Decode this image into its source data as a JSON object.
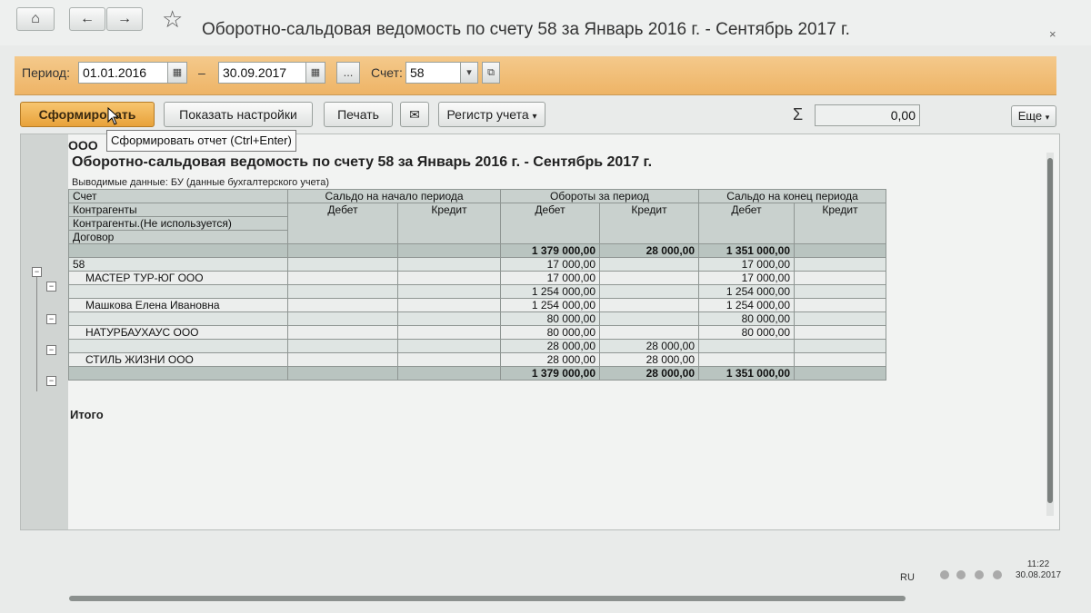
{
  "titlebar": {
    "home_icon": "home-icon",
    "back_icon": "arrow-left-icon",
    "forward_icon": "arrow-right-icon",
    "favorite_icon": "star-icon",
    "title": "Оборотно-сальдовая ведомость по счету 58 за Январь 2016 г. - Сентябрь 2017 г.",
    "close_label": "×"
  },
  "period": {
    "label": "Период:",
    "from": "01.01.2016",
    "dash": "–",
    "to": "30.09.2017",
    "more_label": "...",
    "account_label": "Счет:",
    "account_value": "58"
  },
  "toolbar": {
    "generate_label": "Сформировать",
    "settings_label": "Показать настройки",
    "print_label": "Печать",
    "register_label": "Регистр учета",
    "sum_symbol": "Σ",
    "sum_value": "0,00",
    "more_label": "Еще"
  },
  "tooltip": "Сформировать отчет (Ctrl+Enter)",
  "report": {
    "org": "ООО",
    "title": "Оборотно-сальдовая ведомость по счету 58 за Январь 2016 г. - Сентябрь 2017 г.",
    "output_label": "Выводимые данные:",
    "output_value": "БУ (данные бухгалтерского учета)",
    "headers": {
      "account": "Счет",
      "contractors": "Контрагенты",
      "contractors2": "Контрагенты.(Не используется)",
      "contract": "Договор",
      "opening": "Сальдо на начало периода",
      "turnover": "Обороты за период",
      "closing": "Сальдо на конец периода",
      "debit": "Дебет",
      "credit": "Кредит"
    },
    "rows": [
      {
        "name": "",
        "t_dt": "1 379 000,00",
        "t_ct": "28 000,00",
        "c_dt": "1 351 000,00"
      },
      {
        "name": "58",
        "t_dt": "17 000,00",
        "t_ct": "",
        "c_dt": "17 000,00"
      },
      {
        "name": "МАСТЕР ТУР-ЮГ ООО",
        "t_dt": "17 000,00",
        "t_ct": "",
        "c_dt": "17 000,00"
      },
      {
        "name": "",
        "t_dt": "1 254 000,00",
        "t_ct": "",
        "c_dt": "1 254 000,00"
      },
      {
        "name": "Машкова Елена Ивановна",
        "t_dt": "1 254 000,00",
        "t_ct": "",
        "c_dt": "1 254 000,00"
      },
      {
        "name": "",
        "t_dt": "80 000,00",
        "t_ct": "",
        "c_dt": "80 000,00"
      },
      {
        "name": "НАТУРБАУХАУС ООО",
        "t_dt": "80 000,00",
        "t_ct": "",
        "c_dt": "80 000,00"
      },
      {
        "name": "",
        "t_dt": "28 000,00",
        "t_ct": "28 000,00",
        "c_dt": ""
      },
      {
        "name": "СТИЛЬ ЖИЗНИ ООО",
        "t_dt": "28 000,00",
        "t_ct": "28 000,00",
        "c_dt": ""
      }
    ],
    "total": {
      "label": "Итого",
      "t_dt": "1 379 000,00",
      "t_ct": "28 000,00",
      "c_dt": "1 351 000,00"
    }
  },
  "taskbar": {
    "lang": "RU",
    "time": "11:22",
    "date": "30.08.2017"
  }
}
